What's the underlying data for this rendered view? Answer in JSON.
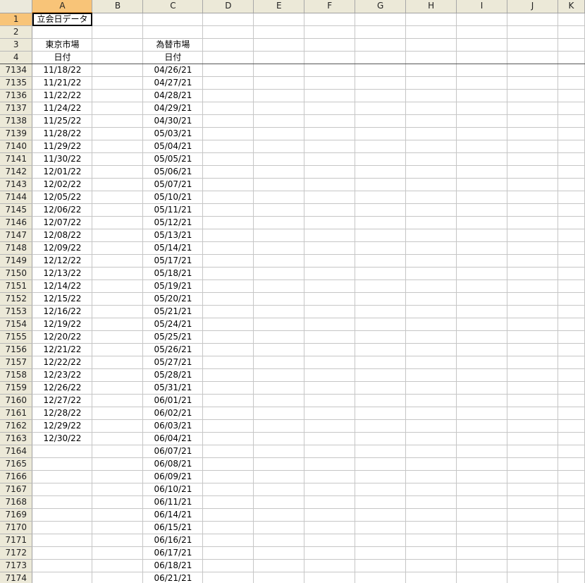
{
  "columns": [
    "A",
    "B",
    "C",
    "D",
    "E",
    "F",
    "G",
    "H",
    "I",
    "J",
    "K"
  ],
  "header_rows": [
    {
      "row": "1",
      "a": "立会日データ",
      "c": ""
    },
    {
      "row": "2",
      "a": "",
      "c": ""
    },
    {
      "row": "3",
      "a": "東京市場",
      "c": "為替市場"
    },
    {
      "row": "4",
      "a": "日付",
      "c": "日付"
    }
  ],
  "rows": [
    {
      "row": "7134",
      "a": "11/18/22",
      "c": "04/26/21"
    },
    {
      "row": "7135",
      "a": "11/21/22",
      "c": "04/27/21"
    },
    {
      "row": "7136",
      "a": "11/22/22",
      "c": "04/28/21"
    },
    {
      "row": "7137",
      "a": "11/24/22",
      "c": "04/29/21"
    },
    {
      "row": "7138",
      "a": "11/25/22",
      "c": "04/30/21"
    },
    {
      "row": "7139",
      "a": "11/28/22",
      "c": "05/03/21"
    },
    {
      "row": "7140",
      "a": "11/29/22",
      "c": "05/04/21"
    },
    {
      "row": "7141",
      "a": "11/30/22",
      "c": "05/05/21"
    },
    {
      "row": "7142",
      "a": "12/01/22",
      "c": "05/06/21"
    },
    {
      "row": "7143",
      "a": "12/02/22",
      "c": "05/07/21"
    },
    {
      "row": "7144",
      "a": "12/05/22",
      "c": "05/10/21"
    },
    {
      "row": "7145",
      "a": "12/06/22",
      "c": "05/11/21"
    },
    {
      "row": "7146",
      "a": "12/07/22",
      "c": "05/12/21"
    },
    {
      "row": "7147",
      "a": "12/08/22",
      "c": "05/13/21"
    },
    {
      "row": "7148",
      "a": "12/09/22",
      "c": "05/14/21"
    },
    {
      "row": "7149",
      "a": "12/12/22",
      "c": "05/17/21"
    },
    {
      "row": "7150",
      "a": "12/13/22",
      "c": "05/18/21"
    },
    {
      "row": "7151",
      "a": "12/14/22",
      "c": "05/19/21"
    },
    {
      "row": "7152",
      "a": "12/15/22",
      "c": "05/20/21"
    },
    {
      "row": "7153",
      "a": "12/16/22",
      "c": "05/21/21"
    },
    {
      "row": "7154",
      "a": "12/19/22",
      "c": "05/24/21"
    },
    {
      "row": "7155",
      "a": "12/20/22",
      "c": "05/25/21"
    },
    {
      "row": "7156",
      "a": "12/21/22",
      "c": "05/26/21"
    },
    {
      "row": "7157",
      "a": "12/22/22",
      "c": "05/27/21"
    },
    {
      "row": "7158",
      "a": "12/23/22",
      "c": "05/28/21"
    },
    {
      "row": "7159",
      "a": "12/26/22",
      "c": "05/31/21"
    },
    {
      "row": "7160",
      "a": "12/27/22",
      "c": "06/01/21"
    },
    {
      "row": "7161",
      "a": "12/28/22",
      "c": "06/02/21"
    },
    {
      "row": "7162",
      "a": "12/29/22",
      "c": "06/03/21"
    },
    {
      "row": "7163",
      "a": "12/30/22",
      "c": "06/04/21"
    },
    {
      "row": "7164",
      "a": "",
      "c": "06/07/21"
    },
    {
      "row": "7165",
      "a": "",
      "c": "06/08/21"
    },
    {
      "row": "7166",
      "a": "",
      "c": "06/09/21"
    },
    {
      "row": "7167",
      "a": "",
      "c": "06/10/21"
    },
    {
      "row": "7168",
      "a": "",
      "c": "06/11/21"
    },
    {
      "row": "7169",
      "a": "",
      "c": "06/14/21"
    },
    {
      "row": "7170",
      "a": "",
      "c": "06/15/21"
    },
    {
      "row": "7171",
      "a": "",
      "c": "06/16/21"
    },
    {
      "row": "7172",
      "a": "",
      "c": "06/17/21"
    },
    {
      "row": "7173",
      "a": "",
      "c": "06/18/21"
    },
    {
      "row": "7174",
      "a": "",
      "c": "06/21/21"
    }
  ]
}
